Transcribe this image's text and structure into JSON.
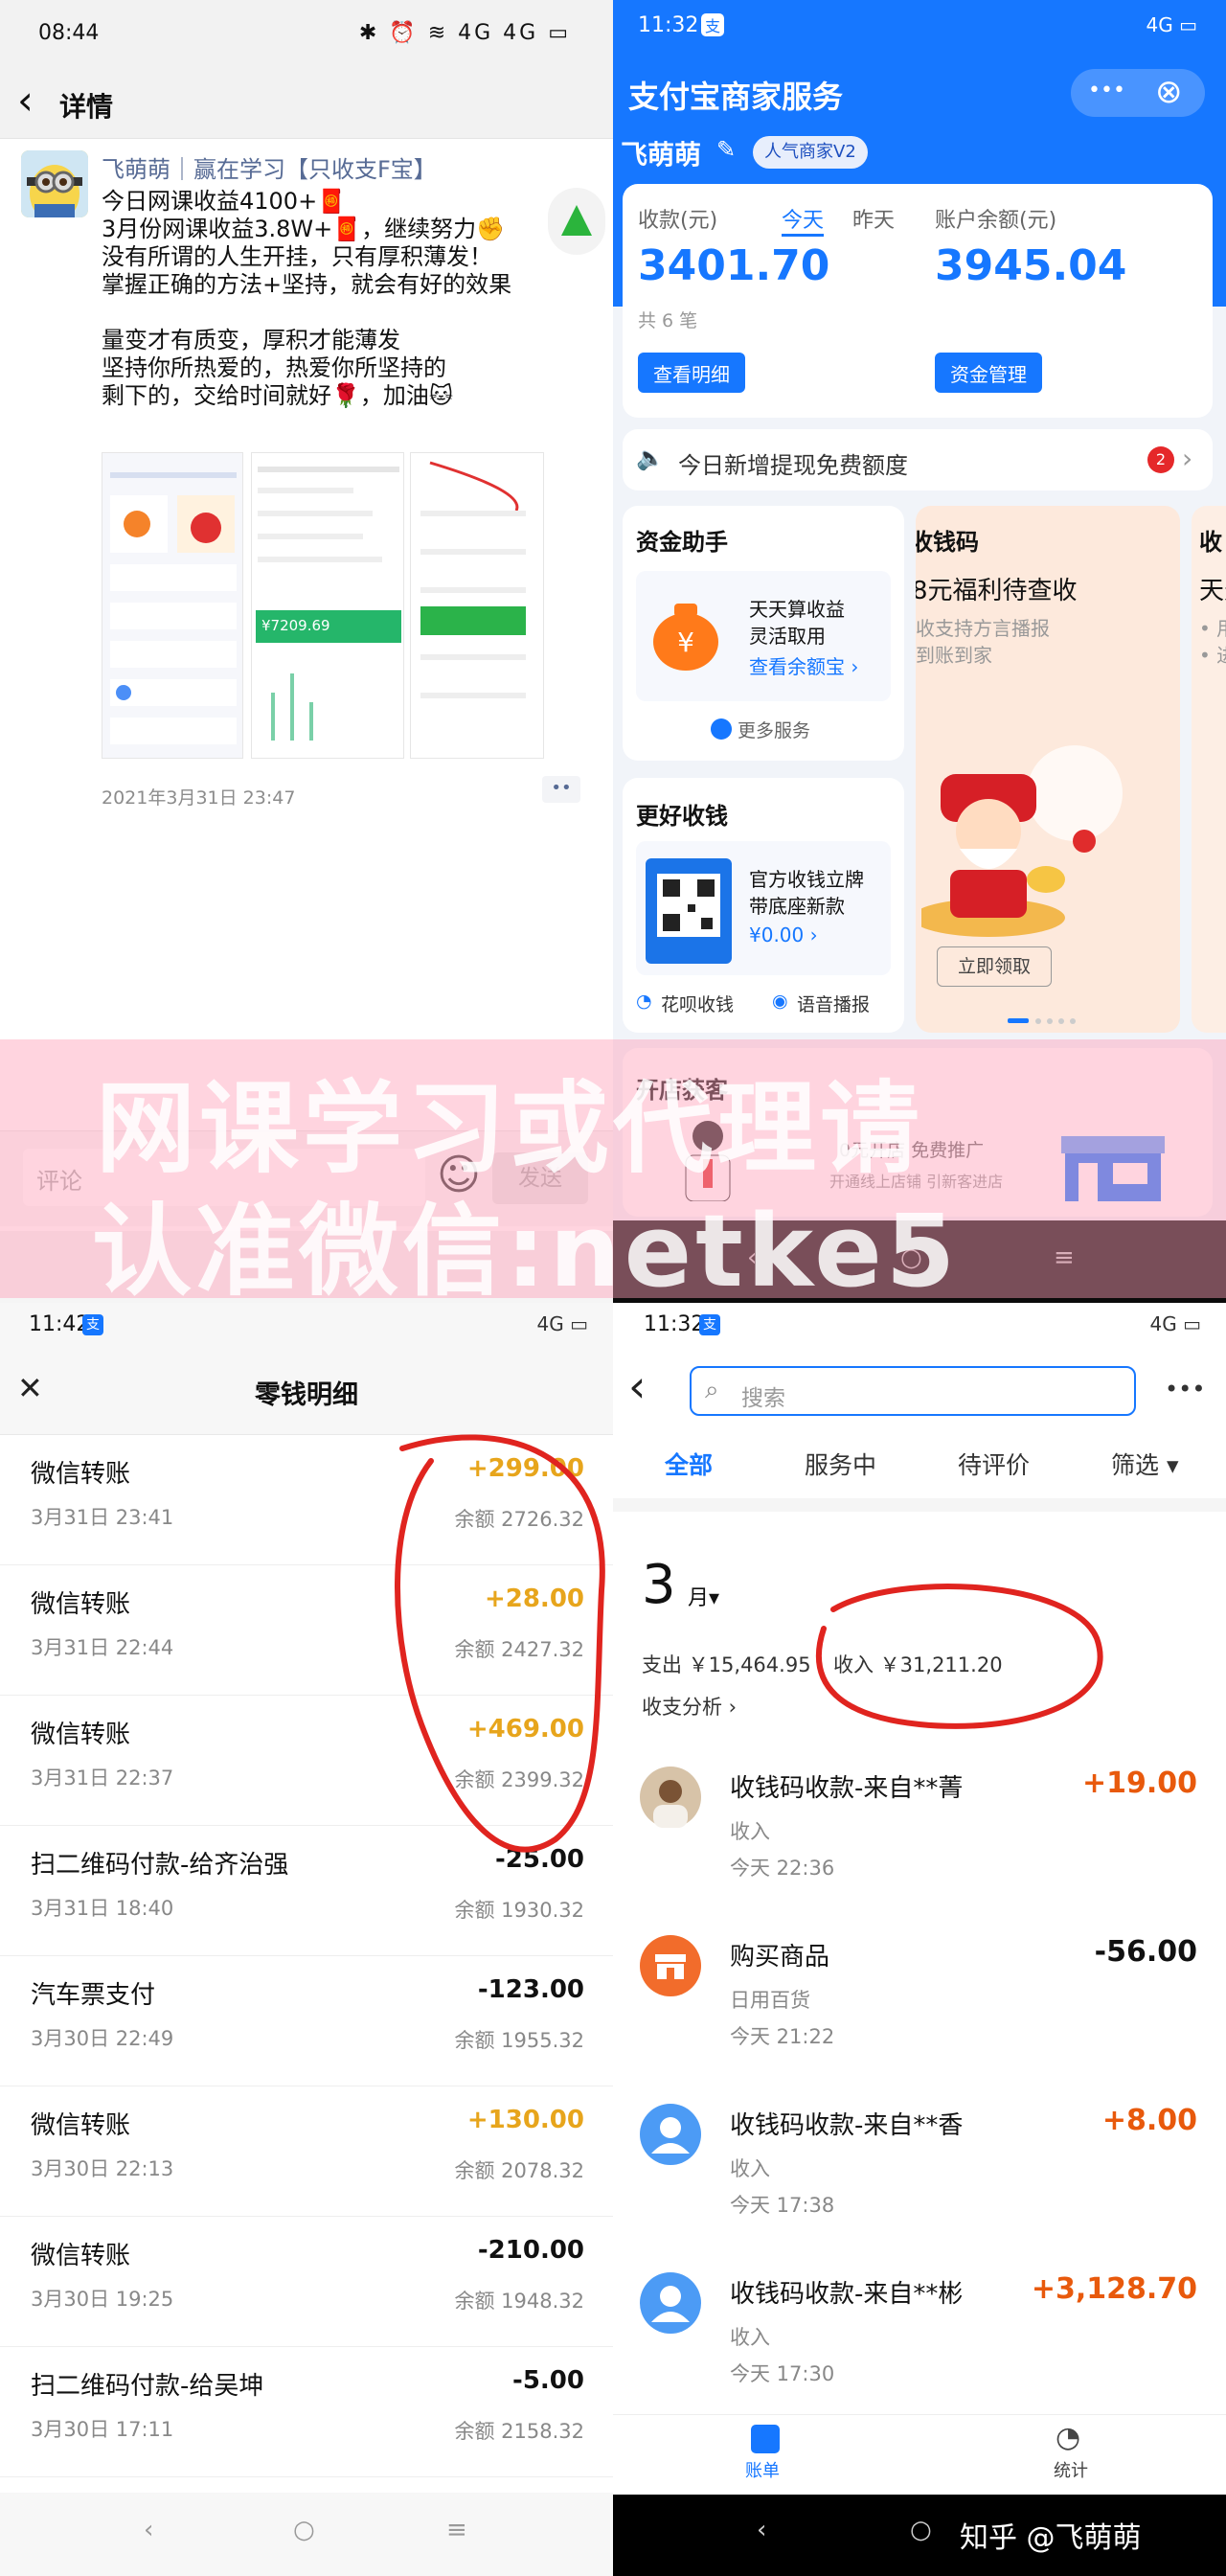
{
  "top_left": {
    "status": {
      "time": "08:44",
      "icons": "✱ ⏰ ≋ 4G 4G ▭"
    },
    "nav": {
      "back": "‹",
      "title": "详情"
    },
    "post": {
      "author": "飞萌萌｜赢在学习【只收支F宝】",
      "lines": [
        "今日网课收益4100+🧧",
        "3月份网课收益3.8W+🧧，继续努力✊",
        "没有所谓的人生开挂，只有厚积薄发！",
        "掌握正确的方法+坚持，就会有好的效果",
        "",
        "量变才有质变，厚积才能薄发",
        "坚持你所热爱的，热爱你所坚持的",
        "剩下的，交给时间就好🌹，加油🐱"
      ],
      "thumb_amount": "¥7209.69",
      "timestamp": "2021年3月31日 23:47",
      "more": "••"
    },
    "comment": {
      "placeholder": "评论",
      "emoji": "☺",
      "send": "发送"
    }
  },
  "top_right": {
    "status": {
      "time": "11:32",
      "badge": "支",
      "icons": "4G ▭"
    },
    "header": {
      "title": "支付宝商家服务",
      "more": "•••",
      "close": "⊗"
    },
    "merchant": {
      "name": "飞萌萌",
      "edit": "✎",
      "badge": "人气商家V2"
    },
    "summary": {
      "income_label": "收款(元)",
      "tab_today": "今天",
      "tab_yesterday": "昨天",
      "balance_label": "账户余额(元)",
      "income_value": "3401.70",
      "balance_value": "3945.04",
      "count": "共 6 笔",
      "btn_detail": "查看明细",
      "btn_manage": "资金管理"
    },
    "notice": {
      "text": "今日新增提现免费额度",
      "badge": "2"
    },
    "fund_card": {
      "title": "资金助手",
      "line1": "天天算收益",
      "line2": "灵活取用",
      "link": "查看余额宝 ›",
      "more": "更多服务"
    },
    "promo_card": {
      "title": "收钱码",
      "subtitle": "8元福利待查收",
      "desc1": "收支持方言播报",
      "desc2": "到账到家",
      "button": "立即领取"
    },
    "side_card": {
      "title": "收",
      "line": "天天",
      "b1": "• 用支",
      "b2": "• 进提"
    },
    "better_card": {
      "title": "更好收钱",
      "line1": "官方收钱立牌",
      "line2": "带底座新款",
      "price": "¥0.00 ›",
      "f1": "花呗收钱",
      "f2": "语音播报"
    },
    "shop_card": {
      "title": "开店获客",
      "line1": "0元开店 免费推广",
      "line2": "开通线上店铺 引新客进店"
    }
  },
  "watermark": {
    "line1": "网课学习或代理请",
    "line2": "认准微信:netke5"
  },
  "bottom_left": {
    "status": {
      "time": "11:42",
      "badge": "支",
      "icons": "4G ▭"
    },
    "header": {
      "close": "✕",
      "title": "零钱明细"
    },
    "rows": [
      {
        "title": "微信转账",
        "date": "3月31日 23:41",
        "amount": "+299.00",
        "balance": "余额 2726.32",
        "positive": true
      },
      {
        "title": "微信转账",
        "date": "3月31日 22:44",
        "amount": "+28.00",
        "balance": "余额 2427.32",
        "positive": true
      },
      {
        "title": "微信转账",
        "date": "3月31日 22:37",
        "amount": "+469.00",
        "balance": "余额 2399.32",
        "positive": true
      },
      {
        "title": "扫二维码付款-给齐治强",
        "date": "3月31日 18:40",
        "amount": "-25.00",
        "balance": "余额 1930.32",
        "positive": false
      },
      {
        "title": "汽车票支付",
        "date": "3月30日 22:49",
        "amount": "-123.00",
        "balance": "余额 1955.32",
        "positive": false
      },
      {
        "title": "微信转账",
        "date": "3月30日 22:13",
        "amount": "+130.00",
        "balance": "余额 2078.32",
        "positive": true
      },
      {
        "title": "微信转账",
        "date": "3月30日 19:25",
        "amount": "-210.00",
        "balance": "余额 1948.32",
        "positive": false
      },
      {
        "title": "扫二维码付款-给吴坤",
        "date": "3月30日 17:11",
        "amount": "-5.00",
        "balance": "余额 2158.32",
        "positive": false
      }
    ],
    "navkeys": {
      "back": "‹",
      "home": "○",
      "menu": "≡"
    }
  },
  "bottom_right": {
    "status": {
      "time": "11:32",
      "badge": "支",
      "icons": "4G ▭"
    },
    "search": {
      "back": "‹",
      "placeholder": "搜索",
      "more": "•••"
    },
    "tabs": [
      "全部",
      "服务中",
      "待评价",
      "筛选 ▾"
    ],
    "month": {
      "num": "3",
      "unit": "月▾"
    },
    "totals": {
      "expense": "支出 ￥15,464.95",
      "income": "收入 ￥31,211.20",
      "analysis": "收支分析 ›"
    },
    "bills": [
      {
        "title": "收钱码收款-来自**菁",
        "line2": "收入",
        "time": "今天 22:36",
        "amount": "+19.00",
        "icon": "avatar"
      },
      {
        "title": "购买商品",
        "line2": "日用百货",
        "time": "今天 21:22",
        "amount": "-56.00",
        "icon": "shop"
      },
      {
        "title": "收钱码收款-来自**香",
        "line2": "收入",
        "time": "今天 17:38",
        "amount": "+8.00",
        "icon": "user"
      },
      {
        "title": "收钱码收款-来自**彬",
        "line2": "收入",
        "time": "今天 17:30",
        "amount": "+3,128.70",
        "icon": "user"
      }
    ],
    "bottom_tabs": {
      "bill": "账单",
      "stats": "统计"
    },
    "navkeys": {
      "back": "‹",
      "home": "○"
    },
    "credit": "知乎 @飞萌萌"
  },
  "colors": {
    "alipay_blue": "#1677ff",
    "wechat_gold": "#e7a51c",
    "red_circle": "#e0241f",
    "orange": "#e8590c"
  }
}
